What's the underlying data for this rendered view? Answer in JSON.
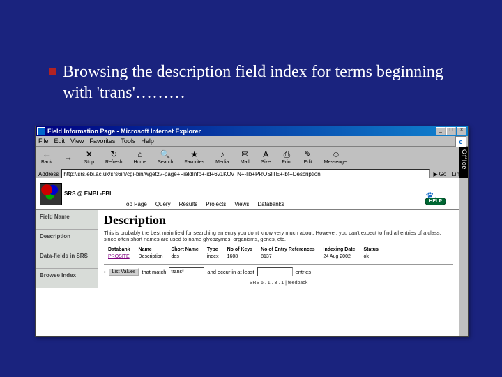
{
  "slide": {
    "title": "Browsing the description field index for terms beginning with 'trans'………"
  },
  "window": {
    "title": "Field Information Page - Microsoft Internet Explorer",
    "office_label": "Office"
  },
  "menu": [
    "File",
    "Edit",
    "View",
    "Favorites",
    "Tools",
    "Help"
  ],
  "toolbar": [
    {
      "label": "Back",
      "glyph": "←",
      "name": "back-button"
    },
    {
      "label": "",
      "glyph": "→",
      "name": "forward-button"
    },
    {
      "label": "Stop",
      "glyph": "✕",
      "name": "stop-button"
    },
    {
      "label": "Refresh",
      "glyph": "↻",
      "name": "refresh-button"
    },
    {
      "label": "Home",
      "glyph": "⌂",
      "name": "home-button"
    },
    {
      "label": "Search",
      "glyph": "🔍",
      "name": "search-button"
    },
    {
      "label": "Favorites",
      "glyph": "★",
      "name": "favorites-button"
    },
    {
      "label": "Media",
      "glyph": "♪",
      "name": "media-button"
    },
    {
      "label": "Mail",
      "glyph": "✉",
      "name": "mail-button"
    },
    {
      "label": "Size",
      "glyph": "A",
      "name": "size-button"
    },
    {
      "label": "Print",
      "glyph": "⎙",
      "name": "print-button"
    },
    {
      "label": "Edit",
      "glyph": "✎",
      "name": "edit-button"
    },
    {
      "label": "Messenger",
      "glyph": "☺",
      "name": "messenger-button"
    }
  ],
  "address": {
    "label": "Address",
    "value": "http://srs.ebi.ac.uk/srs6in/cgi-bin/wgetz?-page+FieldInfo+-id+6v1KOv_N+-lib+PROSITE+-bf+Description",
    "go_label": "Go",
    "links_label": "Links"
  },
  "srs": {
    "logo_text": "SRS @ EMBL-EBI",
    "tabs": [
      "Top Page",
      "Query",
      "Results",
      "Projects",
      "Views",
      "Databanks"
    ],
    "help": "HELP"
  },
  "sidebar": [
    "Field Name",
    "Description",
    "Data-fields in SRS",
    "Browse Index"
  ],
  "field": {
    "title": "Description",
    "description": "This is probably the best main field for searching an entry you don't know very much about. However, you can't expect to find all entries of a class, since often short names are used to name glycozymes, organisms, genes, etc."
  },
  "table": {
    "headers": [
      "Databank",
      "Name",
      "Short Name",
      "Type",
      "No of Keys",
      "No of Entry References",
      "Indexing Date",
      "Status"
    ],
    "row": {
      "databank": "PROSITE",
      "name": "Description",
      "short": "des",
      "type": "index",
      "keys": "1608",
      "refs": "8137",
      "date": "24 Aug 2002",
      "status": "ok"
    }
  },
  "list": {
    "button": "List Values",
    "match_label": "that match",
    "match_value": "trans*",
    "occur_label": "and occur in at least",
    "occur_value": "",
    "entries_label": "entries"
  },
  "footer": "SRS 6 . 1 . 3 . 1  |  feedback"
}
